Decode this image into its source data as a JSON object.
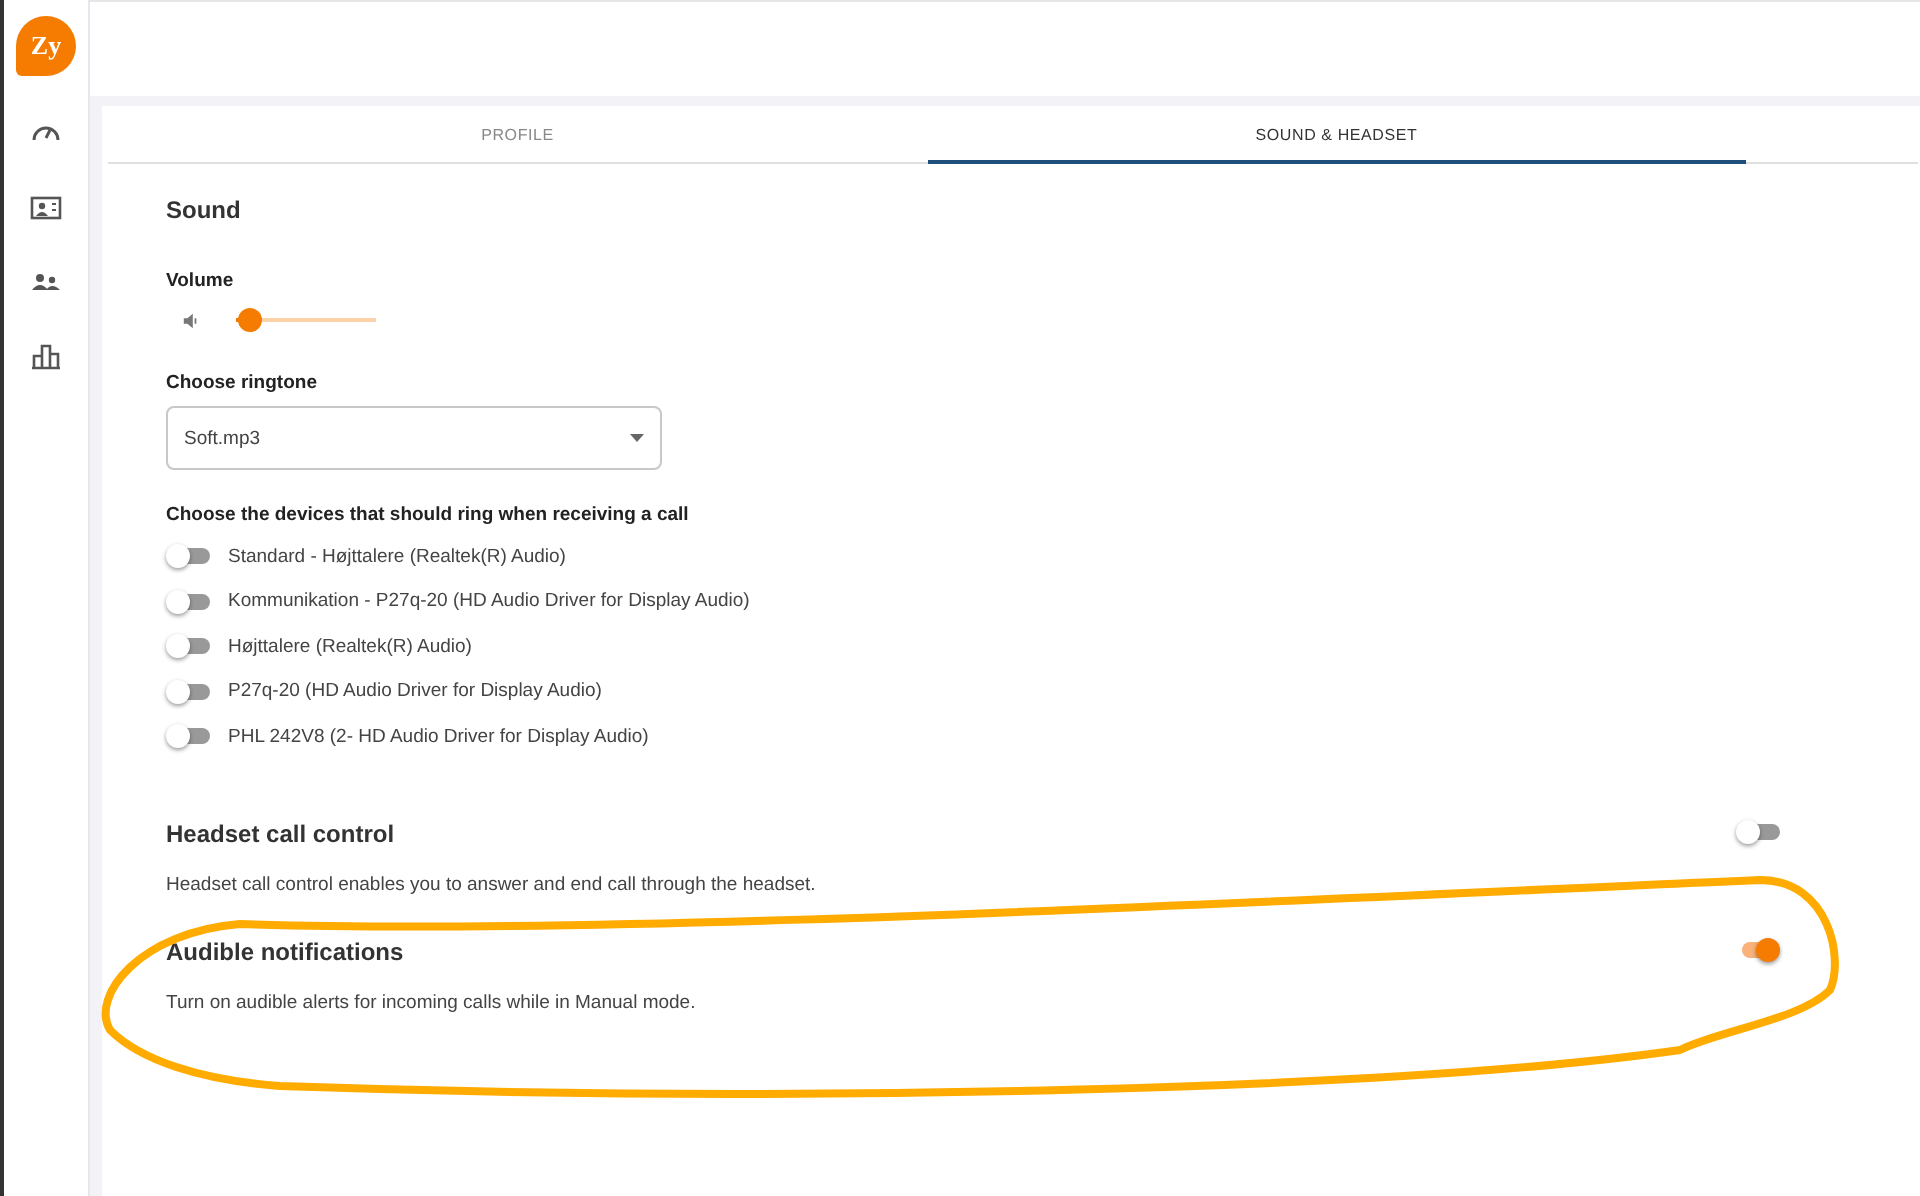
{
  "sidebar": {
    "logo": "Zy",
    "items": [
      {
        "kind": "gauge"
      },
      {
        "kind": "contact-card"
      },
      {
        "kind": "people"
      },
      {
        "kind": "bar-chart"
      }
    ]
  },
  "tabs": [
    {
      "label": "PROFILE",
      "selected": false
    },
    {
      "label": "SOUND & HEADSET",
      "selected": true
    }
  ],
  "sound": {
    "title": "Sound",
    "volume": {
      "label": "Volume",
      "level": 0.1
    },
    "ringtone": {
      "label": "Choose ringtone",
      "value": "Soft.mp3"
    },
    "devices_label": "Choose the devices that should ring when receiving a call",
    "devices": [
      {
        "name": "Standard - Højttalere (Realtek(R) Audio)",
        "on": false
      },
      {
        "name": "Kommunikation - P27q-20 (HD Audio Driver for Display Audio)",
        "on": false
      },
      {
        "name": "Højttalere (Realtek(R) Audio)",
        "on": false
      },
      {
        "name": "P27q-20 (HD Audio Driver for Display Audio)",
        "on": false
      },
      {
        "name": "PHL 242V8 (2- HD Audio Driver for Display Audio)",
        "on": false
      }
    ]
  },
  "settings": [
    {
      "title": "Headset call control",
      "description": "Headset call control enables you to answer and end call through the headset.",
      "on": false
    },
    {
      "title": "Audible notifications",
      "description": "Turn on audible alerts for incoming calls while in Manual mode.",
      "on": true
    }
  ]
}
